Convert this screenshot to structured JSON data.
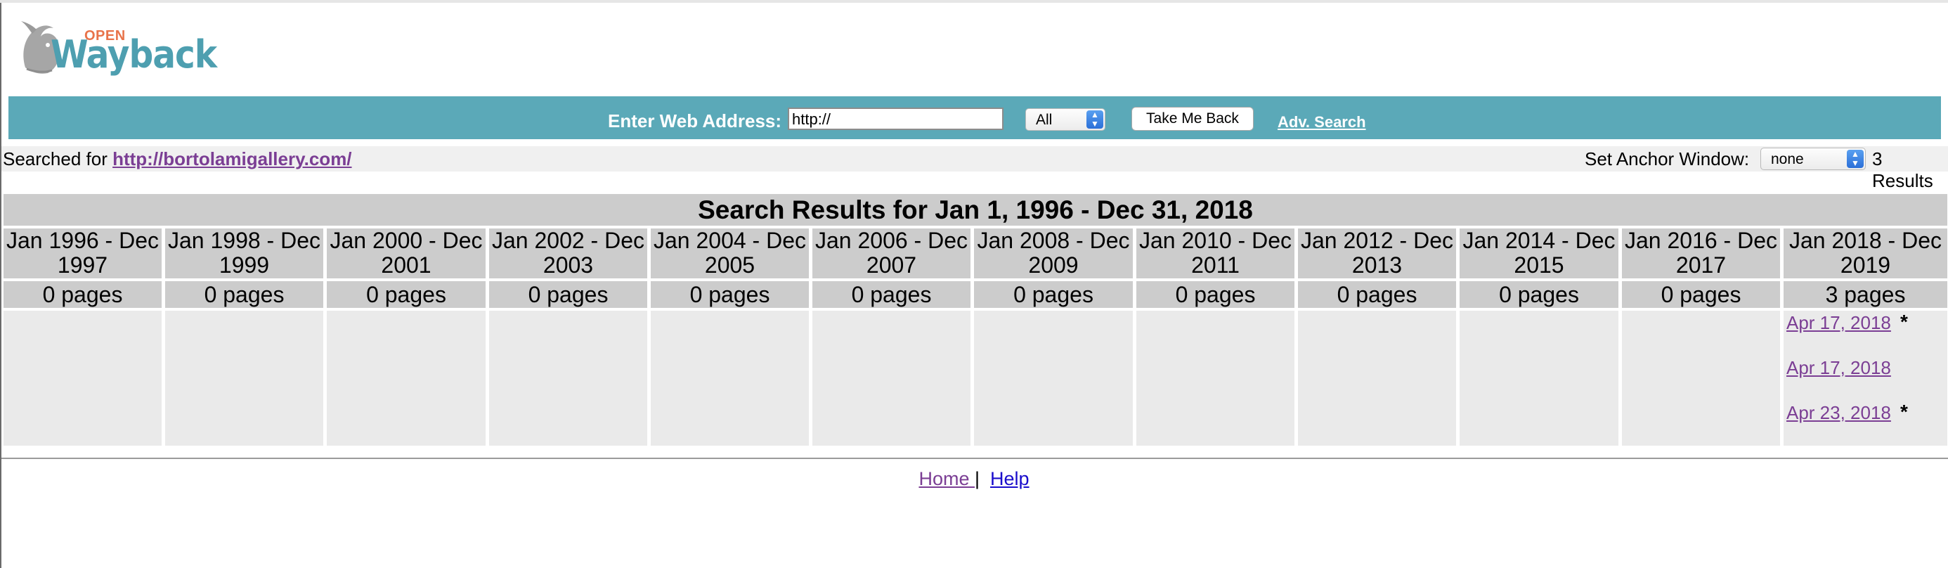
{
  "logo": {
    "top_text": "OPEN",
    "word": "Wayback"
  },
  "searchbar": {
    "label": "Enter Web Address:",
    "input_value": "http://",
    "type_select": "All",
    "submit_label": "Take Me Back",
    "adv_link": "Adv. Search"
  },
  "searched": {
    "prefix": "Searched for ",
    "url": "http://bortolamigallery.com/",
    "anchor_label": "Set Anchor Window:",
    "anchor_value": "none",
    "results_count": "3 Results"
  },
  "results": {
    "title": "Search Results for Jan 1, 1996 - Dec 31, 2018",
    "columns": [
      {
        "line1": "Jan 1996 - Dec",
        "line2": "1997",
        "count": "0 pages"
      },
      {
        "line1": "Jan 1998 - Dec",
        "line2": "1999",
        "count": "0 pages"
      },
      {
        "line1": "Jan 2000 - Dec",
        "line2": "2001",
        "count": "0 pages"
      },
      {
        "line1": "Jan 2002 - Dec",
        "line2": "2003",
        "count": "0 pages"
      },
      {
        "line1": "Jan 2004 - Dec",
        "line2": "2005",
        "count": "0 pages"
      },
      {
        "line1": "Jan 2006 - Dec",
        "line2": "2007",
        "count": "0 pages"
      },
      {
        "line1": "Jan 2008 - Dec",
        "line2": "2009",
        "count": "0 pages"
      },
      {
        "line1": "Jan 2010 - Dec",
        "line2": "2011",
        "count": "0 pages"
      },
      {
        "line1": "Jan 2012 - Dec",
        "line2": "2013",
        "count": "0 pages"
      },
      {
        "line1": "Jan 2014 - Dec",
        "line2": "2015",
        "count": "0 pages"
      },
      {
        "line1": "Jan 2016 - Dec",
        "line2": "2017",
        "count": "0 pages"
      },
      {
        "line1": "Jan 2018 - Dec",
        "line2": "2019",
        "count": "3 pages"
      }
    ],
    "captures": [
      {
        "date": "Apr 17, 2018",
        "mark": "*"
      },
      {
        "date": "Apr 17, 2018",
        "mark": ""
      },
      {
        "date": "Apr 23, 2018",
        "mark": "*"
      }
    ]
  },
  "footer": {
    "home": "Home ",
    "sep": "|",
    "help": "Help"
  },
  "colors": {
    "bar_teal": "#5ba9b8",
    "header_gray": "#cccccc",
    "body_gray": "#eaeaea",
    "visited_link": "#7b3e94",
    "link_blue": "#1a0dcc"
  }
}
